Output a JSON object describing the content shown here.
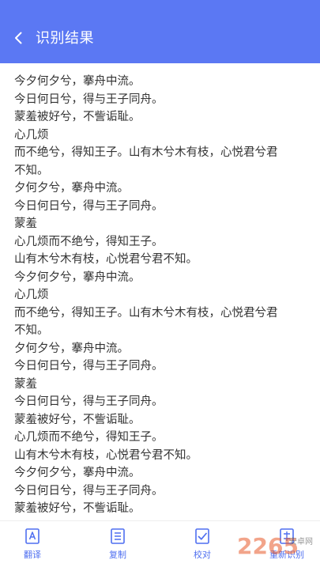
{
  "header": {
    "title": "识别结果"
  },
  "content": {
    "lines": [
      "今夕何夕兮，搴舟中流。",
      "今日何日兮，得与王子同舟。",
      "蒙羞被好兮，不訾诟耻。",
      "心几烦",
      "而不绝兮，得知王子。山有木兮木有枝，心悦君兮君",
      "不知。",
      "夕何夕兮，搴舟中流。",
      "今日何日兮，得与王子同舟。",
      "蒙羞",
      "心几烦而不绝兮，得知王子。",
      "山有木兮木有枝，心悦君兮君不知。",
      "今夕何夕兮，搴舟中流。",
      "心几烦",
      "而不绝兮，得知王子。山有木兮木有枝，心悦君兮君",
      "不知。",
      "夕何夕兮，搴舟中流。",
      "今日何日兮，得与王子同舟。",
      "蒙羞",
      "今日何日兮，得与王子同舟。",
      "蒙羞被好兮，不訾诟耻。",
      "心几烦而不绝兮，得知王子。",
      "山有木兮木有枝，心悦君兮君不知。",
      "今夕何夕兮，搴舟中流。",
      "今日何日兮，得与王子同舟。",
      "蒙羞被好兮，不訾诟耻。"
    ]
  },
  "toolbar": {
    "items": [
      {
        "label": "翻译",
        "icon": "translate-icon"
      },
      {
        "label": "复制",
        "icon": "copy-icon"
      },
      {
        "label": "校对",
        "icon": "proofread-icon"
      },
      {
        "label": "重新识别",
        "icon": "rescan-icon"
      }
    ]
  },
  "watermark": {
    "text": "2265",
    "suffix": "安卓网"
  },
  "colors": {
    "accent": "#5b78f3",
    "text": "#333333",
    "toolbar_icon": "#4f6ff0"
  }
}
